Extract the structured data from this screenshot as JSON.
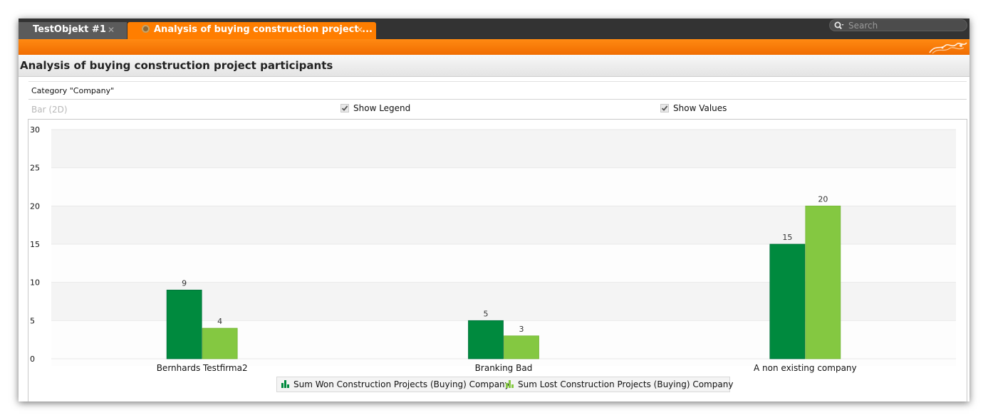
{
  "tabs": [
    {
      "label": "TestObjekt #1",
      "close": "✕",
      "active": false
    },
    {
      "label": "Analysis of buying construction project ...",
      "close": "✕",
      "active": true,
      "icon": "report-icon"
    }
  ],
  "search": {
    "placeholder": "Search",
    "icon": "search-icon"
  },
  "page": {
    "title": "Analysis of buying construction project participants"
  },
  "category": {
    "label": "Category \"Company\""
  },
  "options": {
    "chart_type": "Bar (2D)",
    "show_legend": {
      "label": "Show Legend",
      "checked": true
    },
    "show_values": {
      "label": "Show Values",
      "checked": true
    }
  },
  "colors": {
    "accent": "#ff7e00",
    "tabbar": "#333333",
    "won": "#008a3e",
    "lost": "#84c841"
  },
  "chart_data": {
    "type": "bar",
    "categories": [
      "Bernhards Testfirma2",
      "Branking Bad",
      "A non existing company"
    ],
    "series": [
      {
        "name": "Sum Won Construction Projects (Buying) Company",
        "values": [
          9,
          5,
          15
        ],
        "color": "#008a3e"
      },
      {
        "name": "Sum Lost Construction Projects (Buying) Company",
        "values": [
          4,
          3,
          20
        ],
        "color": "#84c841"
      }
    ],
    "ylim": [
      0,
      30
    ],
    "yticks": [
      0,
      5,
      10,
      15,
      20,
      25,
      30
    ],
    "show_values": true,
    "legend": "bottom",
    "grid": true
  }
}
